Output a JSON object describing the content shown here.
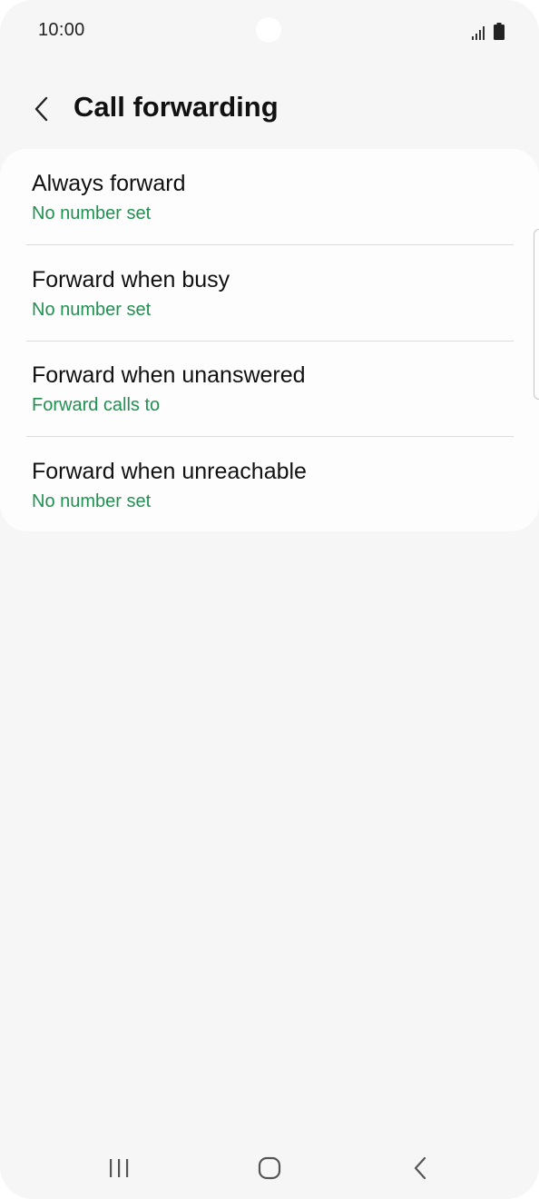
{
  "status_bar": {
    "time": "10:00",
    "icons": [
      "signal-icon",
      "battery-icon"
    ]
  },
  "header": {
    "back_icon": "chevron-left-icon",
    "title": "Call forwarding"
  },
  "items": [
    {
      "title": "Always forward",
      "subtitle": "No number set"
    },
    {
      "title": "Forward when busy",
      "subtitle": "No number set"
    },
    {
      "title": "Forward when unanswered",
      "subtitle": "Forward calls to"
    },
    {
      "title": "Forward when unreachable",
      "subtitle": "No number set"
    }
  ],
  "nav_bar": {
    "icons": [
      "recents-icon",
      "home-icon",
      "back-icon"
    ]
  },
  "colors": {
    "accent": "#1f9150",
    "background": "#f6f6f6",
    "card": "#fdfdfd",
    "text_primary": "#111111"
  }
}
